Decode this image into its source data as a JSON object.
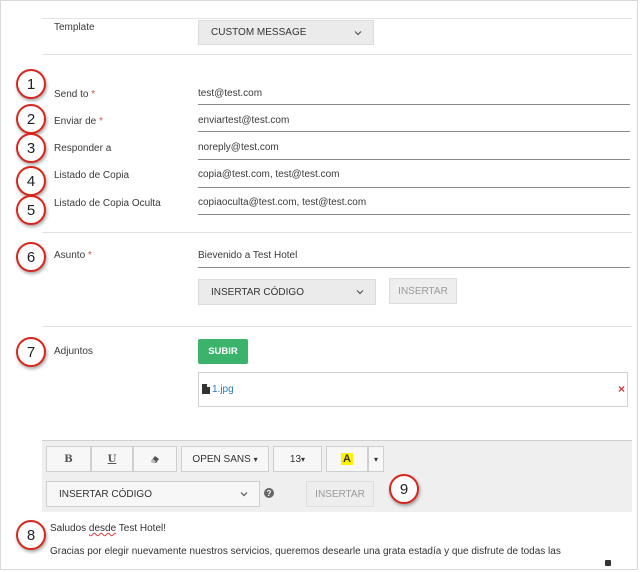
{
  "template": {
    "label": "Template",
    "selected": "CUSTOM MESSAGE"
  },
  "fields": [
    {
      "label": "Send to",
      "required": "*",
      "value": "test@test.com"
    },
    {
      "label": "Enviar de",
      "required": "*",
      "value": "enviartest@test.com"
    },
    {
      "label": "Responder a",
      "required": "",
      "value": "noreply@test.com"
    },
    {
      "label": "Listado de Copia",
      "required": "",
      "value": "copia@test.com, test@test.com"
    },
    {
      "label": "Listado de Copia Oculta",
      "required": "",
      "value": "copiaoculta@test.com, test@test.com"
    }
  ],
  "subject": {
    "label": "Asunto",
    "required": "*",
    "value": "Bievenido a Test Hotel",
    "insert_code_select": "INSERTAR CÓDIGO",
    "insert_button": "INSERTAR"
  },
  "attachments": {
    "label": "Adjuntos",
    "upload_button": "SUBIR",
    "file_name": "1.jpg",
    "remove_glyph": "×"
  },
  "toolbar": {
    "bold": "B",
    "underline": "U",
    "eraser_icon": "eraser-icon",
    "font": "OPEN SANS",
    "font_caret": "▾",
    "size": "13",
    "size_caret": "▾",
    "color_letter": "A",
    "color_highlight": "#fff200",
    "color_caret": "▾",
    "insert_code_select": "INSERTAR CÓDIGO",
    "help_glyph": "?",
    "insert_button": "INSERTAR"
  },
  "editor": {
    "line1_a": "Saludos ",
    "line1_b": "desde",
    "line1_c": " Test Hotel!",
    "line2": "Gracias por elegir nuevamente nuestros servicios, queremos desearle una grata estadía y que disfrute de todas las"
  },
  "badges": [
    "1",
    "2",
    "3",
    "4",
    "5",
    "6",
    "7",
    "8",
    "9"
  ],
  "colors": {
    "badge_border": "#d9261c",
    "required": "#d9534f",
    "upload": "#3bb36b",
    "file_link": "#2a7ab8",
    "remove": "#e0393e"
  }
}
